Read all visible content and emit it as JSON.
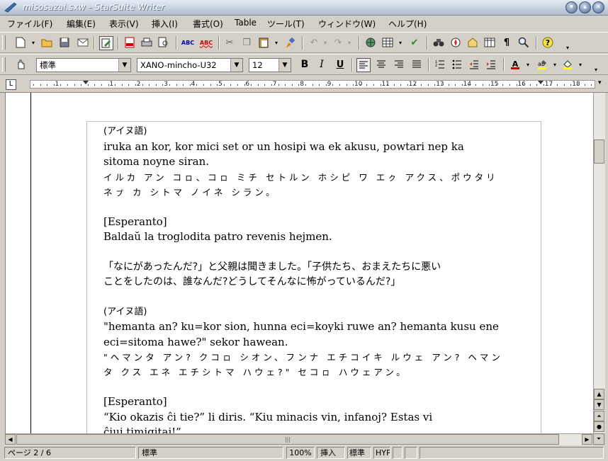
{
  "window": {
    "title": "misosazai.sxw - StarSuite Writer"
  },
  "menu": [
    "ファイル(F)",
    "編集(E)",
    "表示(V)",
    "挿入(I)",
    "書式(O)",
    "Table",
    "ツール(T)",
    "ウィンドウ(W)",
    "ヘルプ(H)"
  ],
  "format": {
    "style": "標準",
    "font": "XANO-mincho-U32",
    "size": "12"
  },
  "document": {
    "blocks": [
      {
        "type": "sec",
        "text": "(アイヌ語)"
      },
      {
        "type": "latin",
        "text": "iruka an kor, kor mici set or un hosipi wa ek akusu, powtari nep ka"
      },
      {
        "type": "latin",
        "text": "sitoma noyne siran."
      },
      {
        "type": "jp",
        "text": "イルカ アン コㇿ、コㇿ ミチ セトルン ホシピ ワ エㇰ アクス、ポウタリ"
      },
      {
        "type": "jp",
        "text": "ネㇷ゚ カ シトマ ノイネ シラン。"
      },
      {
        "type": "gap"
      },
      {
        "type": "latin",
        "text": "[Esperanto]"
      },
      {
        "type": "latin",
        "text": "Baldaŭ la troglodita patro revenis hejmen."
      },
      {
        "type": "gap"
      },
      {
        "type": "jp2",
        "text": "「なにがあったんだ?」と父親は聞きました。「子供たち、おまえたちに悪い"
      },
      {
        "type": "jp2",
        "text": "ことをしたのは、誰なんだ?どうしてそんなに怖がっているんだ?」"
      },
      {
        "type": "gap"
      },
      {
        "type": "sec",
        "text": "(アイヌ語)"
      },
      {
        "type": "latin",
        "text": "\"hemanta an? ku=kor sion, hunna eci=koyki ruwe an? hemanta kusu ene"
      },
      {
        "type": "latin",
        "text": "eci=sitoma hawe?\" sekor hawean."
      },
      {
        "type": "jp",
        "text": "\"ヘマンタ アン? クコㇿ シオン、フンナ エチコイキ ルウェ アン? ヘマン"
      },
      {
        "type": "jp",
        "text": "タ クス エネ エチシトマ ハウェ?\" セコㇿ ハウェアン。"
      },
      {
        "type": "gap"
      },
      {
        "type": "latin",
        "text": "[Esperanto]"
      },
      {
        "type": "latin",
        "text": "“Kio okazis ĉi tie?” li diris. “Kiu minacis vin, infanoj? Estas vi"
      },
      {
        "type": "latin",
        "text": "ĉiuj timigitaj!”"
      }
    ]
  },
  "status": {
    "page": "ページ 2 / 6",
    "page_style": "標準",
    "zoom": "100%",
    "insert_mode": "挿入",
    "selection_mode": "標準",
    "hyperlink_mode": "HYP"
  },
  "ruler": {
    "numbers": [
      "1",
      "1",
      "2",
      "3",
      "4",
      "5",
      "6",
      "7",
      "8",
      "9",
      "10",
      "11",
      "12",
      "13",
      "14",
      "15",
      "16",
      "17",
      "18"
    ]
  },
  "colors": {
    "titlebar": "#aebccc",
    "chrome": "#d4d0c8",
    "page": "#ffffff"
  }
}
